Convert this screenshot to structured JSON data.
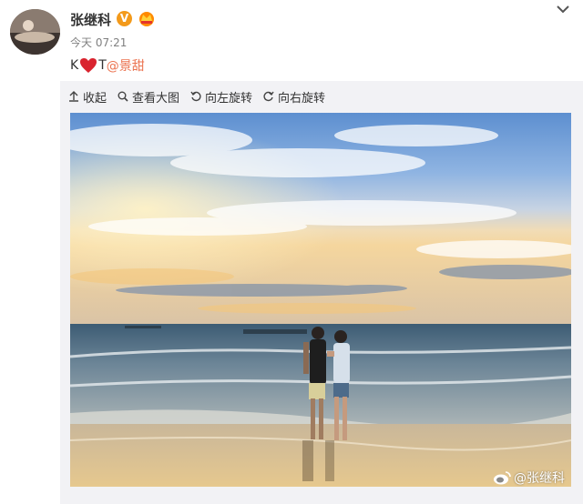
{
  "post": {
    "author": "张继科",
    "time": "今天 07:21",
    "text_prefix": "K",
    "text_mid": "T",
    "mention": "@景甜"
  },
  "toolbar": {
    "collapse": "收起",
    "view_large": "查看大图",
    "rotate_left": "向左旋转",
    "rotate_right": "向右旋转"
  },
  "watermark": {
    "weibo": "@张继科"
  },
  "colors": {
    "mention": "#eb7350",
    "panel_bg": "#f2f2f5",
    "verified_badge": "#f39a1b"
  }
}
